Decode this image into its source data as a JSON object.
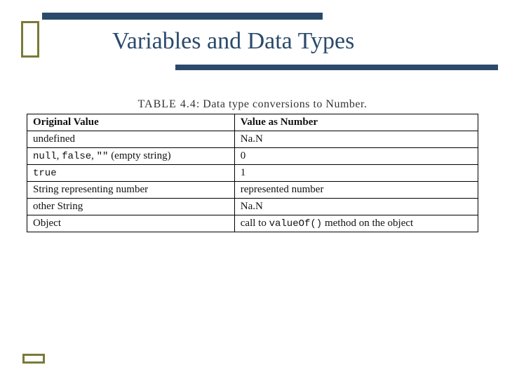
{
  "slide": {
    "title": "Variables and Data Types"
  },
  "table": {
    "caption_label": "TABLE 4.4",
    "caption_text": ": Data type conversions to Number.",
    "header": {
      "col1": "Original Value",
      "col2": "Value as Number"
    },
    "rows": [
      {
        "c1_html": "undefined",
        "c2_html": "Na.N"
      },
      {
        "c1_html": "<span class='tt'>null</span>, <span class='tt'>false</span>, <span class='tt'>\"\"</span> (empty string)",
        "c2_html": "0"
      },
      {
        "c1_html": "<span class='tt'>true</span>",
        "c2_html": "1"
      },
      {
        "c1_html": "String representing number",
        "c2_html": "represented number"
      },
      {
        "c1_html": "other String",
        "c2_html": "Na.N"
      },
      {
        "c1_html": "Object",
        "c2_html": "call to <span class='tt'>valueOf()</span> method on the object"
      }
    ]
  }
}
